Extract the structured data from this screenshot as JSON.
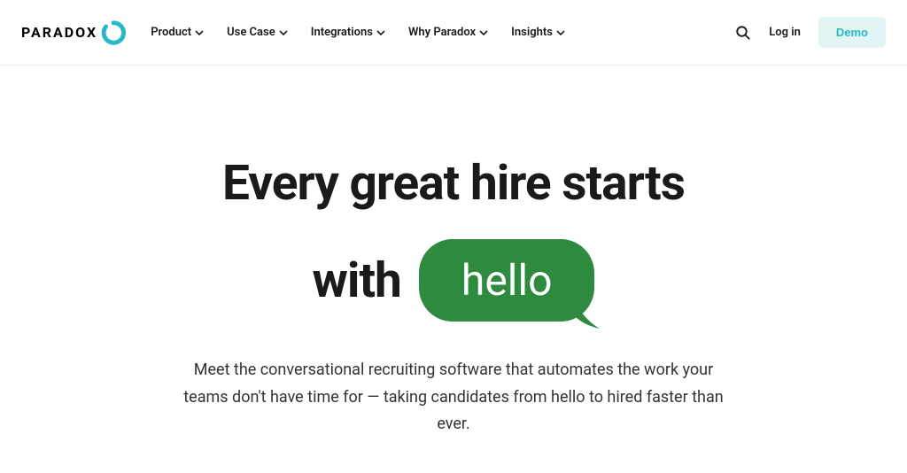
{
  "header": {
    "logo_text": "PARADOX",
    "nav": [
      {
        "label": "Product"
      },
      {
        "label": "Use Case"
      },
      {
        "label": "Integrations"
      },
      {
        "label": "Why Paradox"
      },
      {
        "label": "Insights"
      }
    ],
    "login_label": "Log in",
    "demo_label": "Demo"
  },
  "hero": {
    "title_line1": "Every great hire starts",
    "title_line2_prefix": "with",
    "bubble_text": "hello",
    "subtitle": "Meet the conversational recruiting software that automates the work your teams don't have time for — taking candidates from hello to hired faster than ever."
  },
  "colors": {
    "accent": "#28b8c8",
    "accent_light": "#e1f5f5",
    "bubble_green": "#2d8a3e"
  }
}
